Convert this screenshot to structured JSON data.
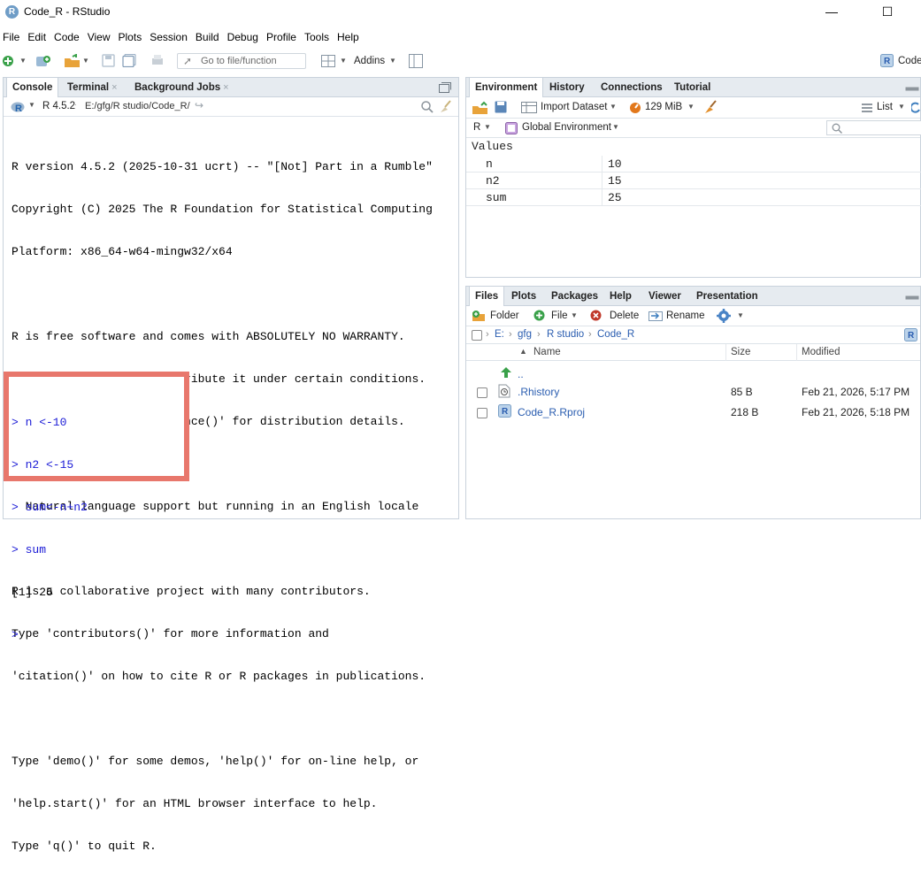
{
  "window": {
    "title": "Code_R - RStudio",
    "minimize_glyph": "—",
    "maximize_glyph": "☐"
  },
  "menu": [
    "File",
    "Edit",
    "Code",
    "View",
    "Plots",
    "Session",
    "Build",
    "Debug",
    "Profile",
    "Tools",
    "Help"
  ],
  "toolbar": {
    "goto_placeholder": "Go to file/function",
    "addins_label": "Addins",
    "project_label": "Code"
  },
  "left_pane": {
    "tabs": [
      "Console",
      "Terminal",
      "Background Jobs"
    ],
    "version": "R 4.5.2",
    "path": "E:/gfg/R studio/Code_R/",
    "startup_lines": [
      "R version 4.5.2 (2025-10-31 ucrt) -- \"[Not] Part in a Rumble\"",
      "Copyright (C) 2025 The R Foundation for Statistical Computing",
      "Platform: x86_64-w64-mingw32/x64",
      "",
      "R is free software and comes with ABSOLUTELY NO WARRANTY.",
      "You are welcome to redistribute it under certain conditions.",
      "Type 'license()' or 'licence()' for distribution details.",
      "",
      "  Natural language support but running in an English locale",
      "",
      "R is a collaborative project with many contributors.",
      "Type 'contributors()' for more information and",
      "'citation()' on how to cite R or R packages in publications.",
      "",
      "Type 'demo()' for some demos, 'help()' for on-line help, or",
      "'help.start()' for an HTML browser interface to help.",
      "Type 'q()' to quit R."
    ],
    "session_lines": [
      {
        "text": "> n <-10",
        "style": "input"
      },
      {
        "text": "> n2 <-15",
        "style": "input"
      },
      {
        "text": "> sum<-n+n2",
        "style": "input"
      },
      {
        "text": "> sum",
        "style": "input"
      },
      {
        "text": "[1] 25",
        "style": "output"
      },
      {
        "text": ">",
        "style": "input"
      }
    ],
    "highlight_color": "#e8776c"
  },
  "env_pane": {
    "tabs": [
      "Environment",
      "History",
      "Connections",
      "Tutorial"
    ],
    "import_label": "Import Dataset",
    "memory_label": "129 MiB",
    "list_label": "List",
    "lang_label": "R",
    "env_label": "Global Environment",
    "section": "Values",
    "rows": [
      {
        "name": "n",
        "value": "10"
      },
      {
        "name": "n2",
        "value": "15"
      },
      {
        "name": "sum",
        "value": "25"
      }
    ]
  },
  "files_pane": {
    "tabs": [
      "Files",
      "Plots",
      "Packages",
      "Help",
      "Viewer",
      "Presentation"
    ],
    "actions": {
      "folder": "Folder",
      "file": "File",
      "delete": "Delete",
      "rename": "Rename"
    },
    "breadcrumb": [
      "E:",
      "gfg",
      "R studio",
      "Code_R"
    ],
    "columns": {
      "name": "Name",
      "size": "Size",
      "modified": "Modified"
    },
    "up_label": "..",
    "files": [
      {
        "name": ".Rhistory",
        "size": "85 B",
        "modified": "Feb 21, 2026, 5:17 PM",
        "icon": "history-file-icon"
      },
      {
        "name": "Code_R.Rproj",
        "size": "218 B",
        "modified": "Feb 21, 2026, 5:18 PM",
        "icon": "rproj-file-icon"
      }
    ]
  },
  "colors": {
    "accent": "#2a5db0",
    "input_text": "#1b1bd6",
    "tab_bg": "#e6ebf0",
    "border": "#c9d2dc"
  }
}
